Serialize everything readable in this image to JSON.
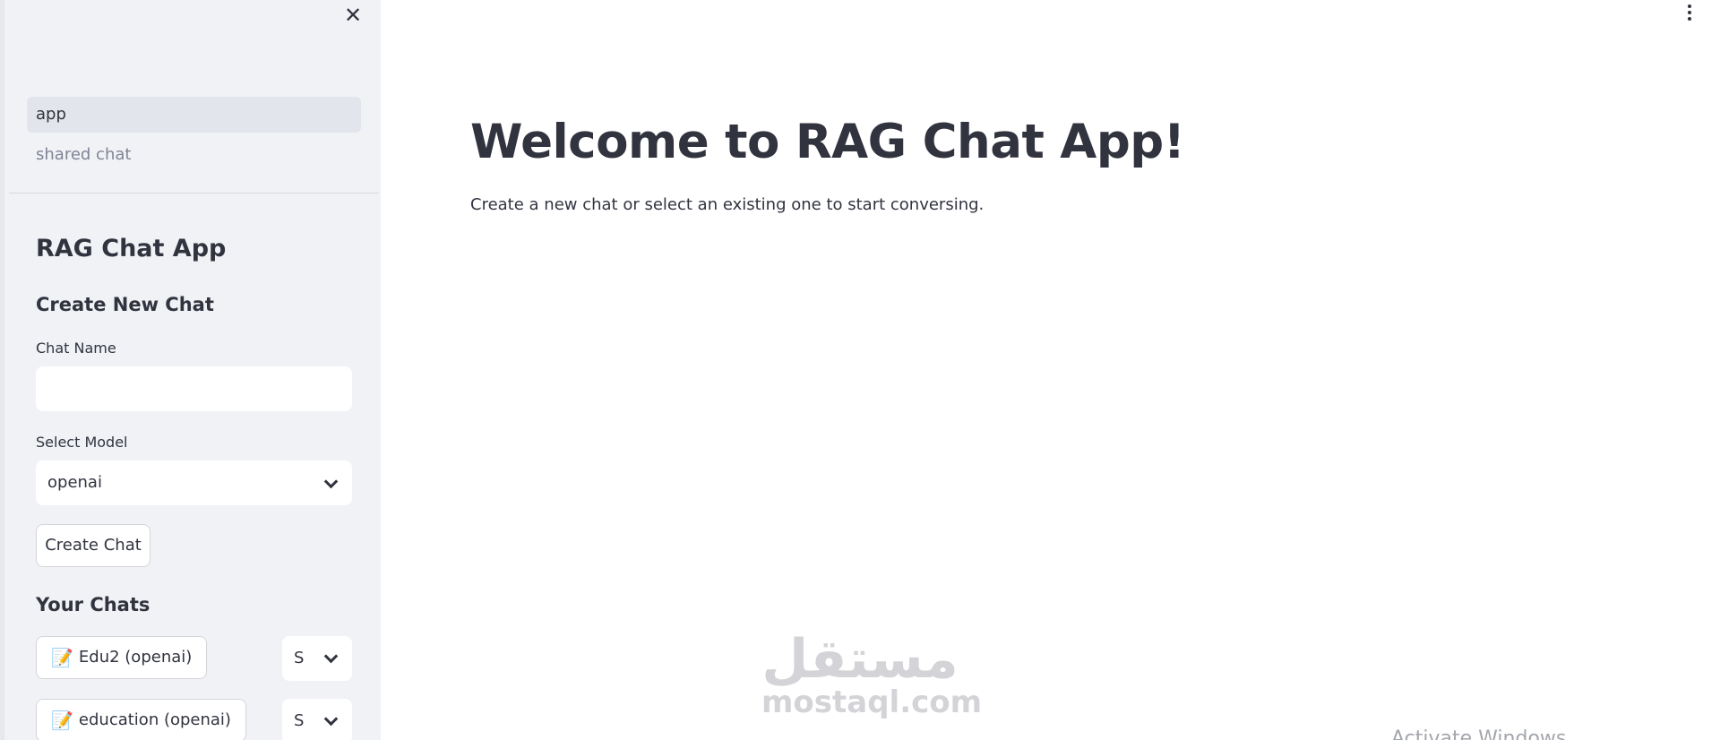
{
  "sidebar": {
    "close_glyph": "✕",
    "nav": [
      {
        "label": "app",
        "active": true
      },
      {
        "label": "shared chat",
        "active": false
      }
    ],
    "title": "RAG Chat App",
    "create_section": {
      "heading": "Create New Chat",
      "chat_name_label": "Chat Name",
      "chat_name_value": "",
      "model_label": "Select Model",
      "model_value": "openai",
      "create_button": "Create Chat"
    },
    "chats_heading": "Your Chats",
    "chats": [
      {
        "label": "Edu2 (openai)",
        "icon": "memo-icon",
        "select_value": "S"
      },
      {
        "label": "education (openai)",
        "icon": "memo-icon",
        "select_value": "S"
      }
    ]
  },
  "main": {
    "title": "Welcome to RAG Chat App!",
    "description": "Create a new chat or select an existing one to start conversing."
  },
  "watermark": {
    "arabic": "مستقل",
    "latin": "mostaql.com"
  },
  "overlay": {
    "activate_text": "Activate Windows"
  }
}
